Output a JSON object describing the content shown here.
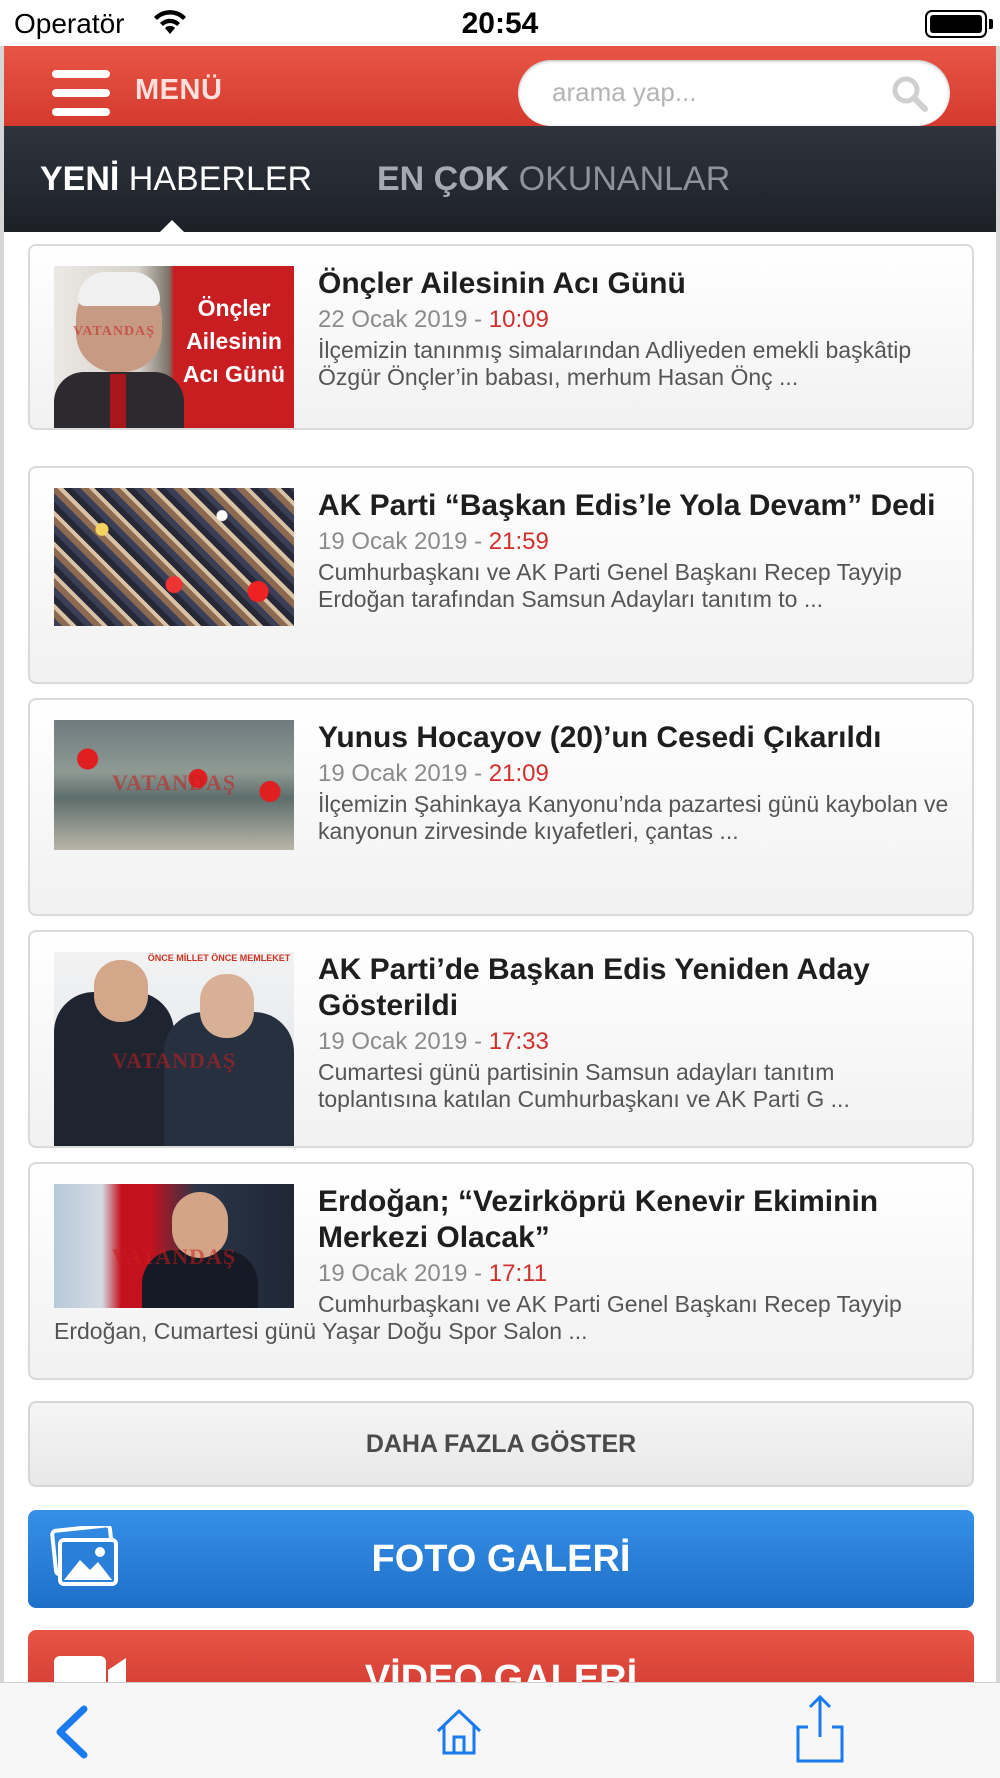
{
  "status_bar": {
    "carrier": "Operatör",
    "time": "20:54"
  },
  "header": {
    "menu_label": "MENÜ",
    "search_placeholder": "arama yap..."
  },
  "tabs": {
    "new_bold": "YENİ",
    "new_rest": " HABERLER",
    "popular_bold": "EN ÇOK",
    "popular_rest": " OKUNANLAR"
  },
  "news": [
    {
      "title": "Önçler Ailesinin Acı Günü",
      "date": "22 Ocak 2019",
      "sep": " - ",
      "time": "10:09",
      "summary": "İlçemizin tanınmış simalarından Adliyeden emekli başkâtip Özgür Önçler’in babası, merhum Hasan Önç ...",
      "image_caption": "Önçler Ailesinin Acı Günü",
      "watermark": "VATANDAŞ"
    },
    {
      "title": "AK Parti “Başkan Edis’le Yola Devam” Dedi",
      "date": "19 Ocak 2019",
      "sep": " - ",
      "time": "21:59",
      "summary": "Cumhurbaşkanı ve AK Parti Genel Başkanı Recep Tayyip Erdoğan tarafından Samsun Adayları tanıtım to ..."
    },
    {
      "title": "Yunus Hocayov (20)’un Cesedi Çıkarıldı",
      "date": "19 Ocak 2019",
      "sep": " - ",
      "time": "21:09",
      "summary": "İlçemizin Şahinkaya Kanyonu’nda pazartesi günü kaybolan ve kanyonun zirvesinde kıyafetleri, çantas ...",
      "watermark": "VATANDAŞ"
    },
    {
      "title": "AK Parti’de Başkan Edis Yeniden Aday Gösterildi",
      "date": "19 Ocak 2019",
      "sep": " - ",
      "time": "17:33",
      "summary": "Cumartesi günü partisinin Samsun adayları tanıtım toplantısına katılan Cumhurbaşkanı ve AK Parti G ...",
      "watermark": "VATANDAŞ",
      "banner": "ÖNCE MİLLET ÖNCE MEMLEKET",
      "poster": "Önce Mille"
    },
    {
      "title": "Erdoğan; “Vezirköprü Kenevir Ekiminin Merkezi Olacak”",
      "date": "19 Ocak 2019",
      "sep": " - ",
      "time": "17:11",
      "summary": "Cumhurbaşkanı ve AK Parti Genel Başkanı Recep Tayyip Erdoğan, Cumartesi günü Yaşar Doğu Spor Salon ...",
      "watermark": "VATANDAŞ"
    }
  ],
  "buttons": {
    "more": "DAHA FAZLA GÖSTER",
    "photo_gallery": "FOTO GALERİ",
    "video_gallery": "VİDEO GALERİ"
  },
  "colors": {
    "brand_red": "#d43a2e",
    "accent_blue": "#1f6fc7",
    "time_red": "#d02f2b",
    "tabbar_dark": "#1d2027"
  },
  "icons": {
    "back": "chevron-left-icon",
    "home": "home-icon",
    "share": "share-icon",
    "search": "search-icon"
  }
}
